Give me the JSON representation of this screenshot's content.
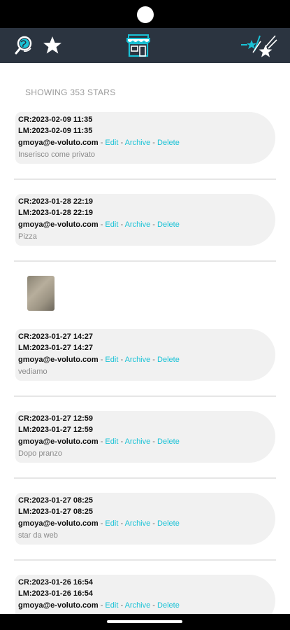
{
  "header": {
    "left_icons": [
      "search-globe-icon",
      "star-icon"
    ],
    "center_icon": "store-icon",
    "right_icon": "shooting-stars-icon"
  },
  "list": {
    "count_label": "SHOWING 353 STARS",
    "actions": {
      "edit": "Edit",
      "archive": "Archive",
      "delete": "Delete",
      "sep": " - "
    },
    "items": [
      {
        "created": "CR:2023-02-09 11:35",
        "modified": "LM:2023-02-09 11:35",
        "author": "gmoya@e-voluto.com",
        "note": "Inserisco come privato"
      },
      {
        "created": "CR:2023-01-28 22:19",
        "modified": "LM:2023-01-28 22:19",
        "author": "gmoya@e-voluto.com",
        "note": "Pizza"
      },
      {
        "created": "CR:2023-01-27 14:27",
        "modified": "LM:2023-01-27 14:27",
        "author": "gmoya@e-voluto.com",
        "note": "vediamo"
      },
      {
        "created": "CR:2023-01-27 12:59",
        "modified": "LM:2023-01-27 12:59",
        "author": "gmoya@e-voluto.com",
        "note": "Dopo pranzo"
      },
      {
        "created": "CR:2023-01-27 08:25",
        "modified": "LM:2023-01-27 08:25",
        "author": "gmoya@e-voluto.com",
        "note": "star da web"
      },
      {
        "created": "CR:2023-01-26 16:54",
        "modified": "LM:2023-01-26 16:54",
        "author": "gmoya@e-voluto.com",
        "note": ""
      }
    ]
  },
  "colors": {
    "app_bar": "#2b3440",
    "accent": "#19c2d6"
  }
}
